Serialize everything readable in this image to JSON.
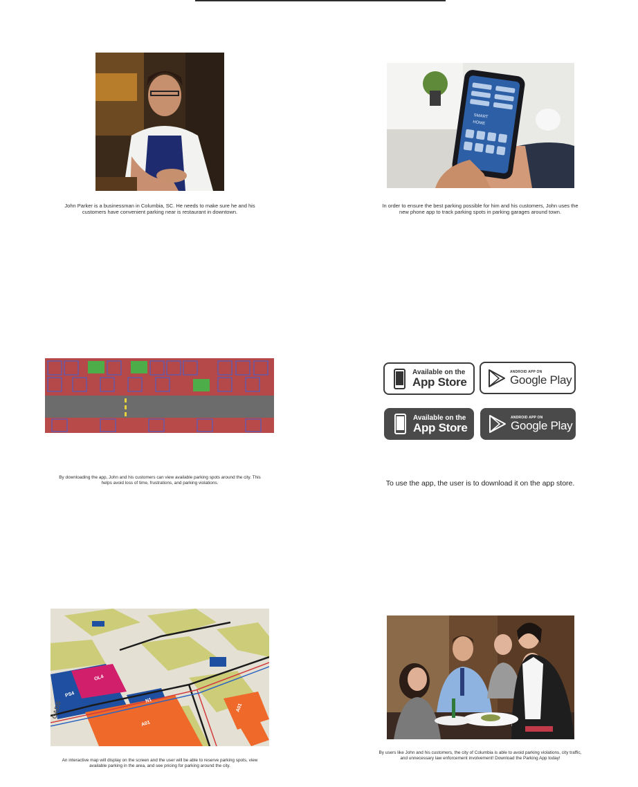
{
  "captions": {
    "c1": "John Parker is a businessman in Columbia, SC. He needs to make sure he and his customers have convenient parking near is restaurant in downtown.",
    "c2": "In order to ensure the best parking possible for him and his customers, John uses the new phone app to track parking spots in parking garages around town.",
    "c3": "By downloading the app, John and his customers can view available parking spots around the city. This helps avoid loss of time, frustrations, and parking violations.",
    "c4": "To use the app, the user is to download it on the app store.",
    "c5": "An interactive map will display on the screen and the user will be able to reserve parking spots, view available parking in the area, and see pricing for parking around the city.",
    "c6": "By users like John and his customers, the city of Columbia is able to avoid parking violations, city traffic, and unnecessary law enforcement involvement! Download the Parking App today!"
  },
  "phone": {
    "smart": "SMART",
    "home": "HOME"
  },
  "badges": {
    "appstore_line1": "Available on the",
    "appstore_line2": "App Store",
    "gplay_line1": "ANDROID APP ON",
    "gplay_line2": "Google Play"
  },
  "map": {
    "labels": [
      "PS4",
      "OL4",
      "A01",
      "N1",
      "A01",
      "GADS"
    ]
  },
  "colors": {
    "accent_dark": "#2d2d2d",
    "badge_fill": "#4a4a4a",
    "map_orange": "#ef6a2a",
    "map_blue": "#1f4fa0",
    "map_magenta": "#d21f6b",
    "parking_red": "#c43a3a",
    "parking_green": "#3bbf4a"
  }
}
